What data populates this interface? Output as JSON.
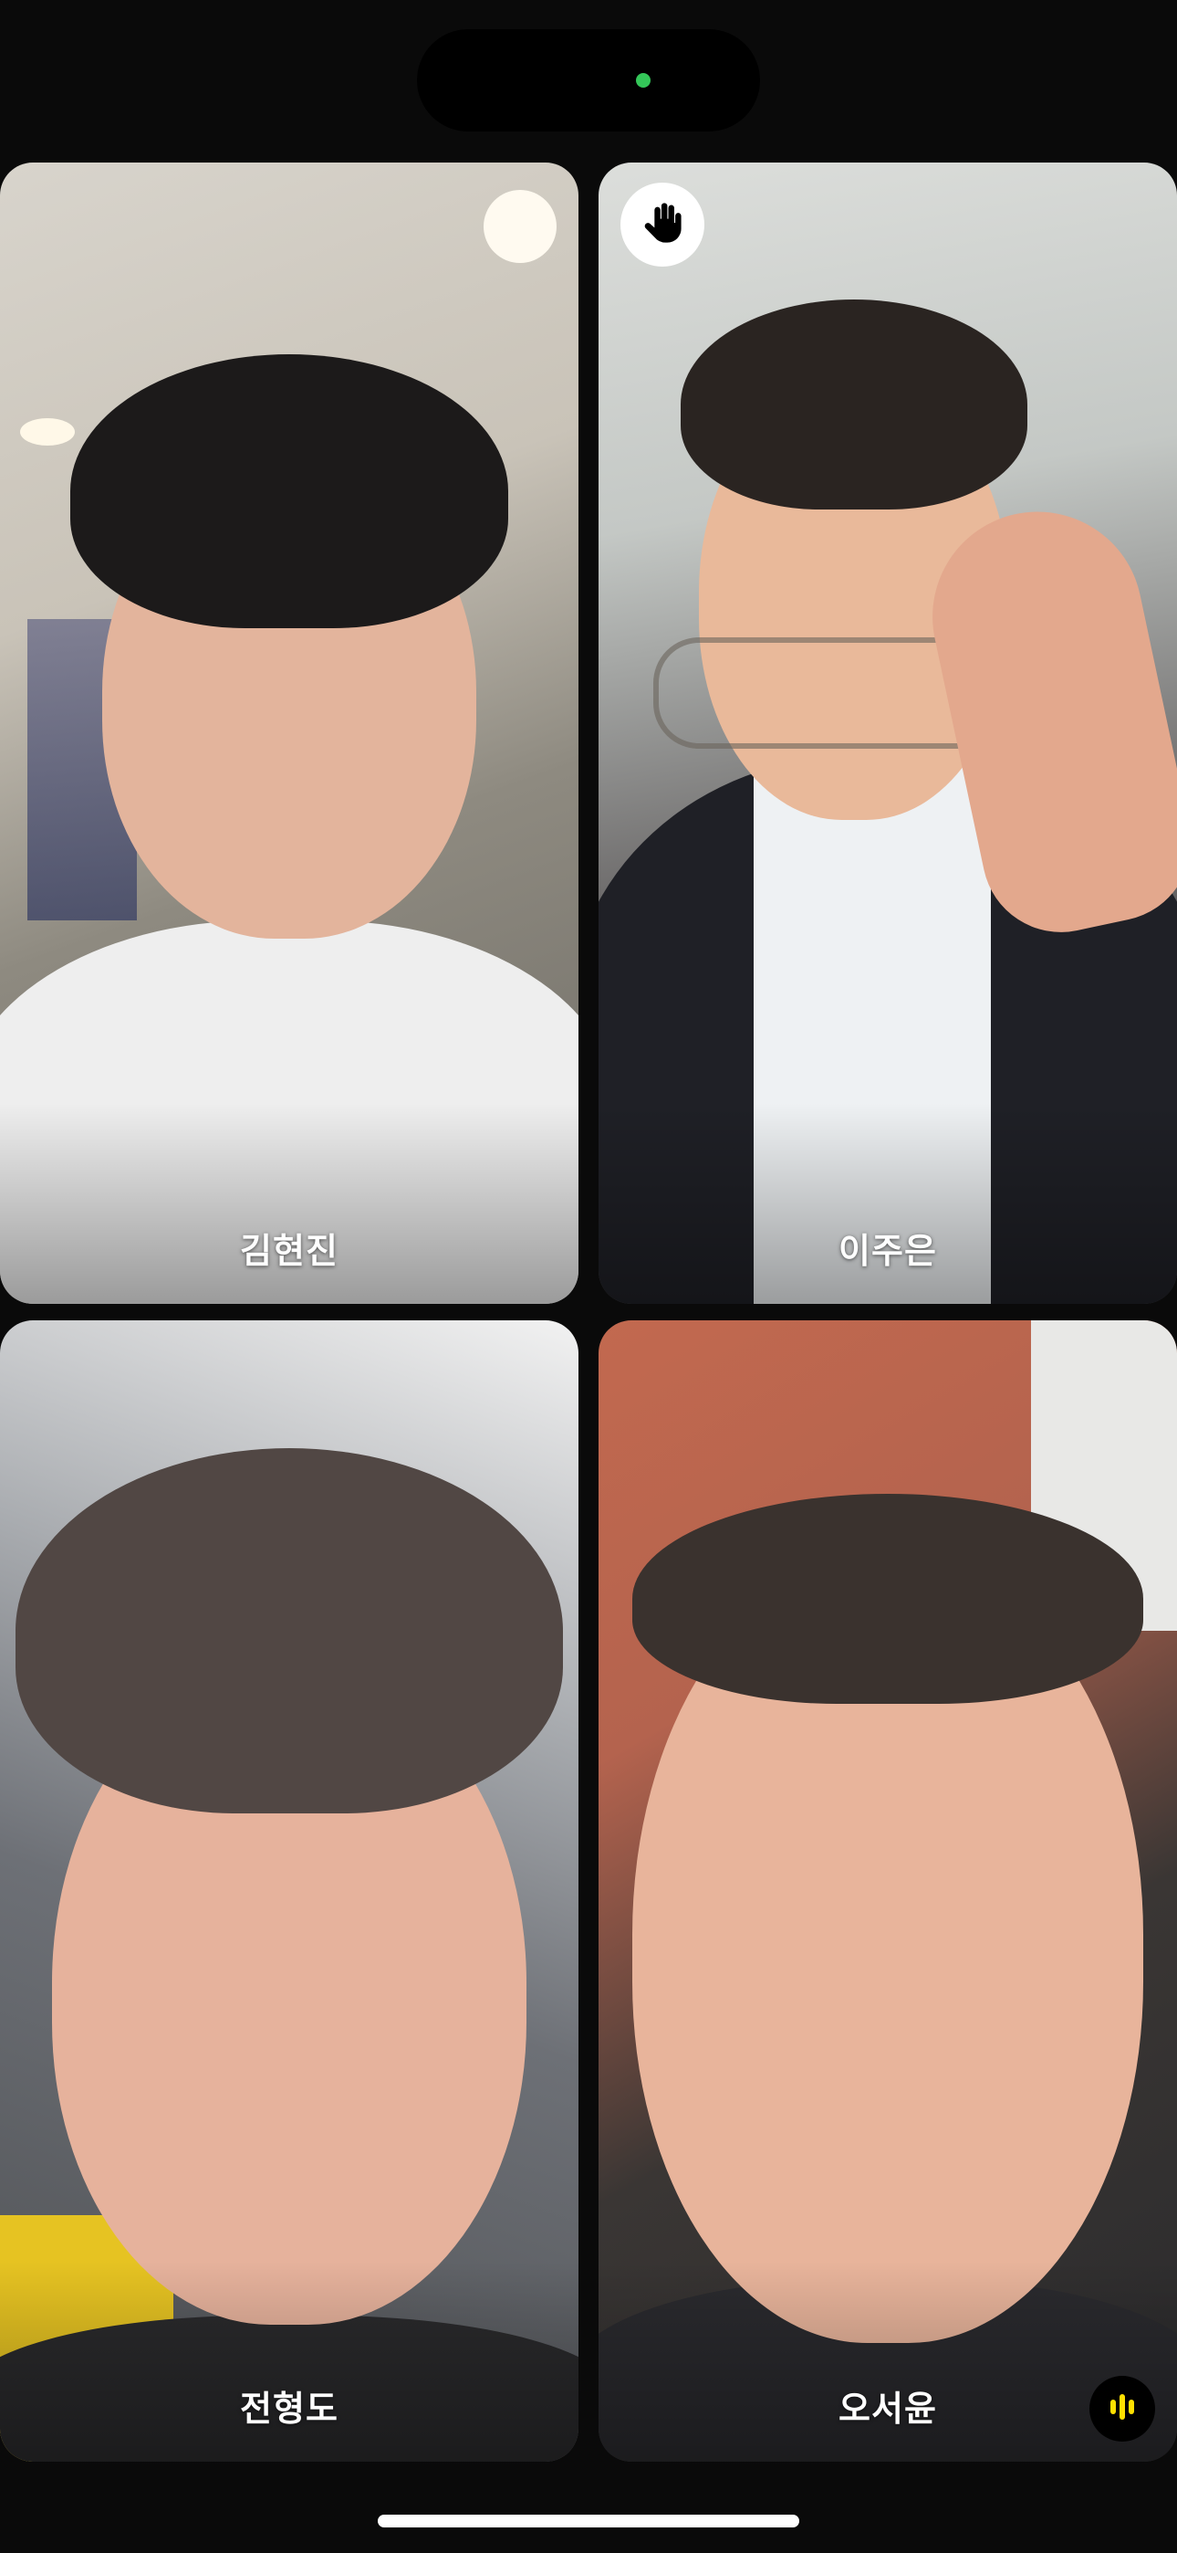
{
  "status": {
    "camera_indicator_color": "#34c759"
  },
  "participants": [
    {
      "name": "김현진",
      "raised_hand": false,
      "speaking": false
    },
    {
      "name": "이주은",
      "raised_hand": true,
      "speaking": false
    },
    {
      "name": "전형도",
      "raised_hand": false,
      "speaking": false
    },
    {
      "name": "오서윤",
      "raised_hand": false,
      "speaking": true
    }
  ],
  "icons": {
    "raised_hand": "raised-hand-icon",
    "speaking": "audio-level-icon"
  },
  "colors": {
    "background": "#0a0a0a",
    "speaking_accent": "#ffe000",
    "name_text": "#ffffff"
  }
}
